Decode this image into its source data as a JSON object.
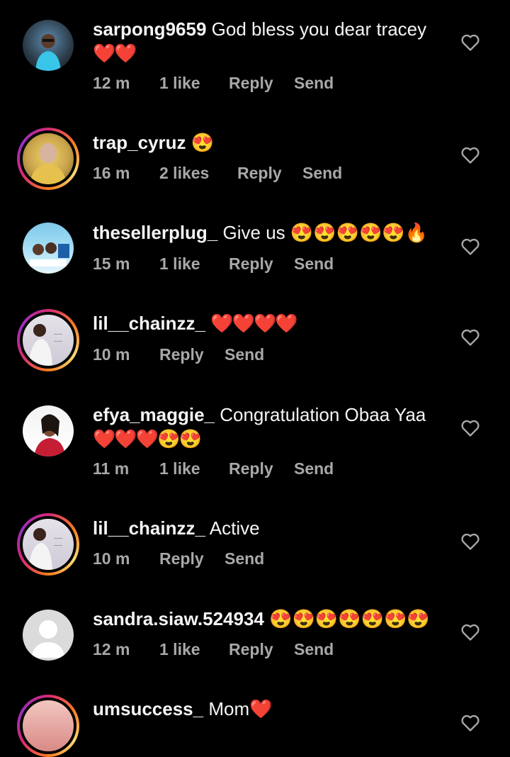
{
  "comments": [
    {
      "username": "sarpong9659",
      "text": "God bless you dear tracey",
      "emoji": "❤️❤️",
      "time": "12 m",
      "likes": "1 like",
      "reply": "Reply",
      "send": "Send"
    },
    {
      "username": "trap_cyruz",
      "text": "",
      "emoji": "😍",
      "time": "16 m",
      "likes": "2 likes",
      "reply": "Reply",
      "send": "Send"
    },
    {
      "username": "thesellerplug_",
      "text": "Give us",
      "emoji": "😍😍😍😍😍🔥",
      "time": "15 m",
      "likes": "1 like",
      "reply": "Reply",
      "send": "Send"
    },
    {
      "username": "lil__chainzz_",
      "text": "",
      "emoji": "❤️❤️❤️❤️",
      "time": "10 m",
      "likes": "",
      "reply": "Reply",
      "send": "Send"
    },
    {
      "username": "efya_maggie_",
      "text": "Congratulation Obaa Yaa",
      "emoji": "❤️❤️❤️😍😍",
      "time": "11 m",
      "likes": "1 like",
      "reply": "Reply",
      "send": "Send"
    },
    {
      "username": "lil__chainzz_",
      "text": "Active",
      "emoji": "",
      "time": "10 m",
      "likes": "",
      "reply": "Reply",
      "send": "Send"
    },
    {
      "username": "sandra.siaw.524934",
      "text": "",
      "emoji": "😍😍😍😍😍😍😍",
      "time": "12 m",
      "likes": "1 like",
      "reply": "Reply",
      "send": "Send"
    },
    {
      "username": "umsuccess_",
      "text": "Mom",
      "emoji": "❤️",
      "time": "",
      "likes": "",
      "reply": "",
      "send": ""
    }
  ],
  "icons": {
    "like": "heart-outline-icon"
  }
}
